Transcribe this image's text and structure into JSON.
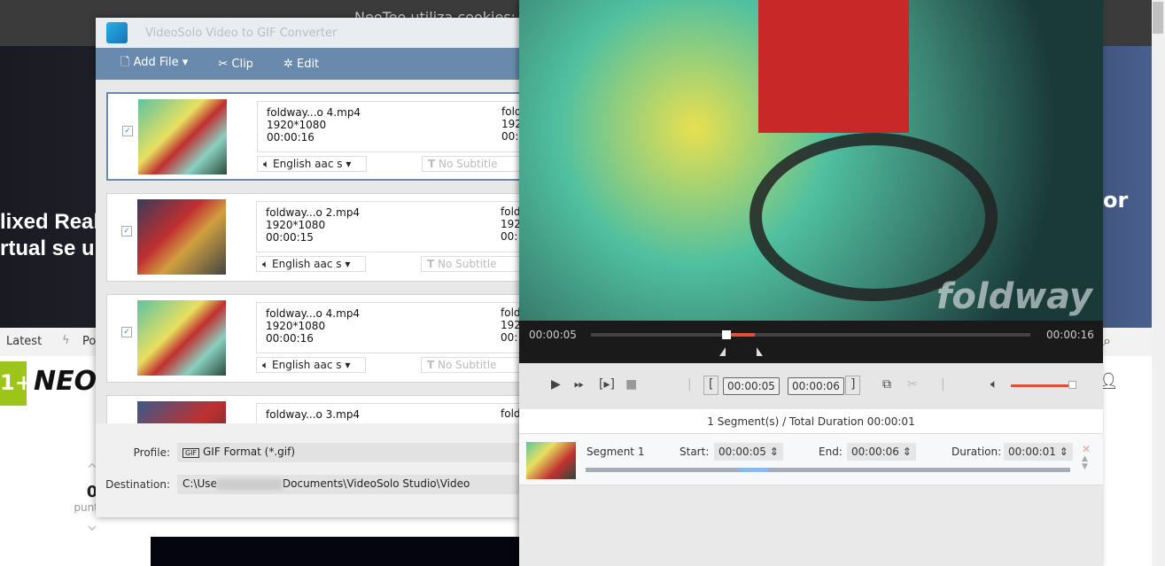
{
  "background_page": {
    "cookie_text": "NeoTeo utiliza cookies: O",
    "hero_line1": "lixed Real",
    "hero_line2": "rtual se u",
    "hero_right": "or",
    "nav": [
      "Latest",
      "Po"
    ],
    "logo": {
      "badge": "1+",
      "name": "NEO"
    },
    "vote_count": "0",
    "vote_label": "puntos"
  },
  "main_window": {
    "title": "VideoSolo Video to GIF Converter",
    "toolbar": {
      "add_file": "Add File",
      "clip": "Clip",
      "edit": "Edit"
    },
    "files": [
      {
        "name": "foldway...o 4.mp4",
        "resolution": "1920*1080",
        "duration": "00:00:16",
        "audio": "English aac s",
        "subtitle": "No Subtitle",
        "output_name": "fold",
        "output_res": "192",
        "output_dur": "00:",
        "checked": true,
        "selected": true
      },
      {
        "name": "foldway...o 2.mp4",
        "resolution": "1920*1080",
        "duration": "00:00:15",
        "audio": "English aac s",
        "subtitle": "No Subtitle",
        "output_name": "fold",
        "output_res": "192",
        "output_dur": "00:",
        "checked": true
      },
      {
        "name": "foldway...o 4.mp4",
        "resolution": "1920*1080",
        "duration": "00:00:16",
        "audio": "English aac s",
        "subtitle": "No Subtitle",
        "output_name": "fold",
        "output_res": "192",
        "output_dur": "00:",
        "checked": true
      },
      {
        "name": "foldway...o 3.mp4",
        "output_name": "fold"
      }
    ],
    "profile_label": "Profile:",
    "profile_value": "GIF Format (*.gif)",
    "destination_label": "Destination:",
    "destination_prefix": "C:\\Use",
    "destination_suffix": "Documents\\VideoSolo Studio\\Video"
  },
  "clip_window": {
    "watermark": "foldway",
    "current_time": "00:00:05",
    "total_time": "00:00:16",
    "start_box": "00:00:05",
    "end_box": "00:00:06",
    "volume_percent": 95,
    "summary": "1 Segment(s) / Total Duration 00:00:01",
    "segments": [
      {
        "name": "Segment 1",
        "start_label": "Start:",
        "start": "00:00:05",
        "end_label": "End:",
        "end": "00:00:06",
        "duration_label": "Duration:",
        "duration": "00:00:01"
      }
    ]
  },
  "colors": {
    "toolbar": "#6a8aad",
    "accent": "#e0503a"
  }
}
